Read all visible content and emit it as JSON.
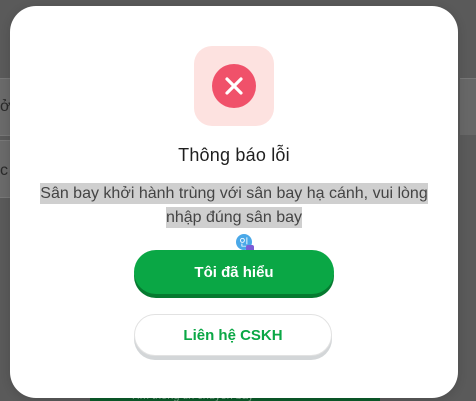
{
  "background_page": {
    "fragments": [
      "ởi",
      "c"
    ],
    "bottom_bar_text": "Tìm thông tin chuyến bay"
  },
  "dialog": {
    "icon": "error-x-circle-icon",
    "title": "Thông báo lỗi",
    "message_line1": "Sân bay khởi hành trùng với sân bay hạ cánh, vui lòng",
    "message_line2": "nhập đúng sân bay",
    "primary_button": "Tôi đã hiểu",
    "secondary_button": "Liên hệ CSKH"
  },
  "colors": {
    "primary_green": "#0aa745",
    "error_red": "#f0516a",
    "error_bg": "#fde2e0",
    "overlay": "#5a5a5a"
  }
}
